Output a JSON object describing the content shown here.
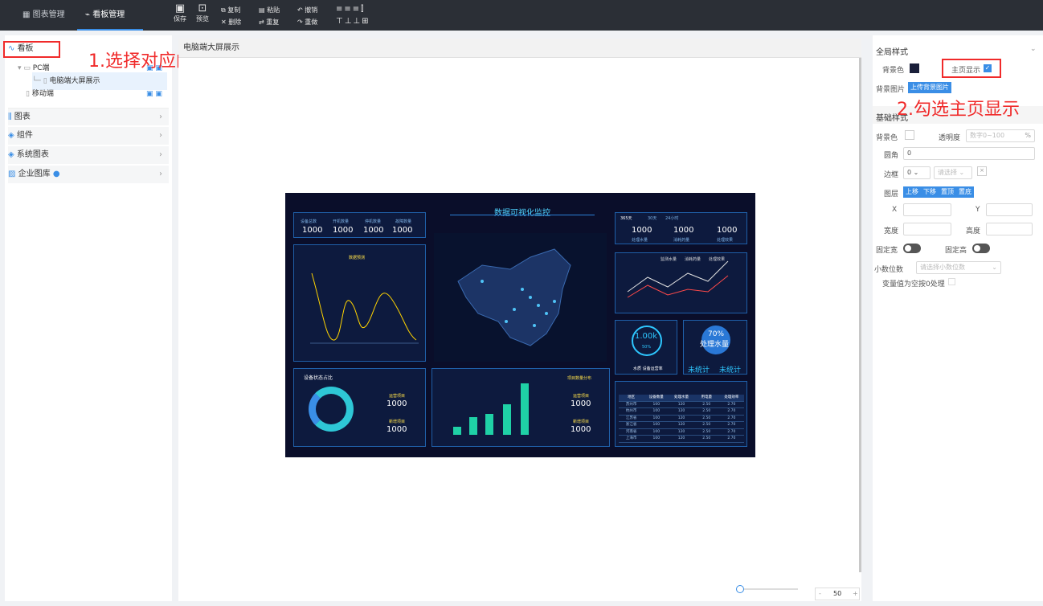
{
  "topbar": {
    "tabs": [
      {
        "label": "图表管理"
      },
      {
        "label": "看板管理"
      }
    ],
    "tools": {
      "save": "保存",
      "preview": "预览",
      "copy": "复制",
      "delete": "删除",
      "paste": "粘贴",
      "redo": "重复",
      "undo": "撤销",
      "redo2": "重做"
    }
  },
  "sidebar": {
    "header": "看板",
    "tree": [
      {
        "label": "PC端"
      },
      {
        "label": "电脑端大屏展示"
      },
      {
        "label": "移动端"
      }
    ],
    "sections": [
      {
        "label": "图表"
      },
      {
        "label": "组件"
      },
      {
        "label": "系统图表"
      },
      {
        "label": "企业图库"
      }
    ]
  },
  "annotations": {
    "step1": "1.选择对应的看板",
    "step2": "2.勾选主页显示"
  },
  "canvas": {
    "title": "电脑端大屏展示",
    "zoom": "50"
  },
  "dashboard": {
    "title": "数据可视化监控",
    "stats_left": [
      {
        "label": "设备总数",
        "value": "1000"
      },
      {
        "label": "开机数量",
        "value": "1000"
      },
      {
        "label": "停机数量",
        "value": "1000"
      },
      {
        "label": "故障数量",
        "value": "1000"
      }
    ],
    "tabs_right": [
      "365天",
      "30天",
      "24小时"
    ],
    "stats_right": [
      {
        "label": "处理水量",
        "value": "1000"
      },
      {
        "label": "消耗药量",
        "value": "1000"
      },
      {
        "label": "处理效果",
        "value": "1000"
      }
    ],
    "line_legend": "数据预测",
    "multi_legend": [
      "监测水量",
      "消耗药量",
      "处理效果"
    ],
    "gauge_value": "1.00k",
    "gauge_pct": "50%",
    "gauge_label": "水质 设备运营率",
    "water_pct": "70%",
    "water_label": "处理水量",
    "uncount1": "未统计",
    "uncount2": "未统计",
    "donut_title": "设备状态占比",
    "donut_values": [
      {
        "label": "运营项目",
        "value": "1000"
      },
      {
        "label": "新增项目",
        "value": "1000"
      }
    ],
    "bar_title": "项目数量分布",
    "bar_values": [
      {
        "label": "运营项目",
        "value": "1000"
      },
      {
        "label": "新增项目",
        "value": "1000"
      }
    ],
    "table_headers": [
      "地区",
      "设备数量",
      "处理水量",
      "用电量",
      "处理效率"
    ],
    "table_rows": [
      [
        "苏州市",
        "100",
        "120",
        "2.50",
        "2.70"
      ],
      [
        "杭州市",
        "100",
        "120",
        "2.50",
        "2.70"
      ],
      [
        "江苏省",
        "100",
        "120",
        "2.50",
        "2.70"
      ],
      [
        "浙江省",
        "100",
        "120",
        "2.50",
        "2.70"
      ],
      [
        "河南省",
        "100",
        "120",
        "2.50",
        "2.70"
      ],
      [
        "上海市",
        "100",
        "120",
        "2.50",
        "2.70"
      ]
    ]
  },
  "panel": {
    "global": "全局样式",
    "bgcolor": "背景色",
    "homepage": "主页显示",
    "bgimage": "背景图片",
    "upload": "上传背景图片",
    "basic": "基础样式",
    "bg2": "背景色",
    "opacity": "透明度",
    "opacity_ph": "数字0~100",
    "pct": "%",
    "radius": "圆角",
    "radius_val": "0",
    "border": "边框",
    "border_val": "0",
    "border_sel": "请选择",
    "layer": "图层",
    "layer_btns": [
      "上移",
      "下移",
      "置顶",
      "置底"
    ],
    "x": "X",
    "y": "Y",
    "width": "宽度",
    "height": "高度",
    "fixw": "固定宽",
    "fixh": "固定高",
    "decimals": "小数位数",
    "decimals_ph": "请选择小数位数",
    "nullzero": "变量值为空按0处理"
  }
}
